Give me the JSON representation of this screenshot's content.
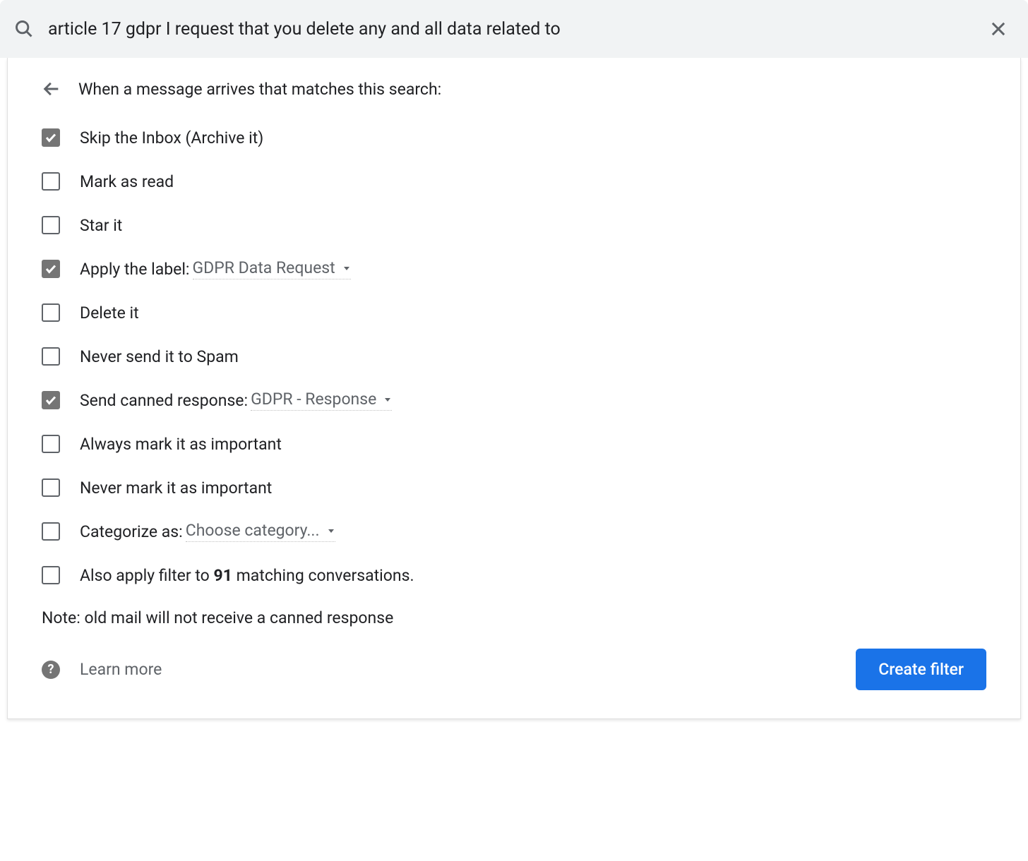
{
  "search": {
    "value": "article 17 gdpr I request that you delete any and all data related to"
  },
  "panel": {
    "title": "When a message arrives that matches this search:"
  },
  "options": {
    "skip_inbox": {
      "label": "Skip the Inbox (Archive it)",
      "checked": true
    },
    "mark_read": {
      "label": "Mark as read",
      "checked": false
    },
    "star": {
      "label": "Star it",
      "checked": false
    },
    "apply_label": {
      "label": "Apply the label:",
      "value": "GDPR Data Request",
      "checked": true
    },
    "delete": {
      "label": "Delete it",
      "checked": false
    },
    "never_spam": {
      "label": "Never send it to Spam",
      "checked": false
    },
    "canned_response": {
      "label": "Send canned response:",
      "value": "GDPR - Response",
      "checked": true
    },
    "always_important": {
      "label": "Always mark it as important",
      "checked": false
    },
    "never_important": {
      "label": "Never mark it as important",
      "checked": false
    },
    "categorize": {
      "label": "Categorize as:",
      "value": "Choose category...",
      "checked": false
    },
    "also_apply": {
      "prefix": "Also apply filter to ",
      "count": "91",
      "suffix": " matching conversations.",
      "checked": false
    }
  },
  "note": "Note: old mail will not receive a canned response",
  "footer": {
    "learn_more": "Learn more",
    "create_button": "Create filter"
  }
}
